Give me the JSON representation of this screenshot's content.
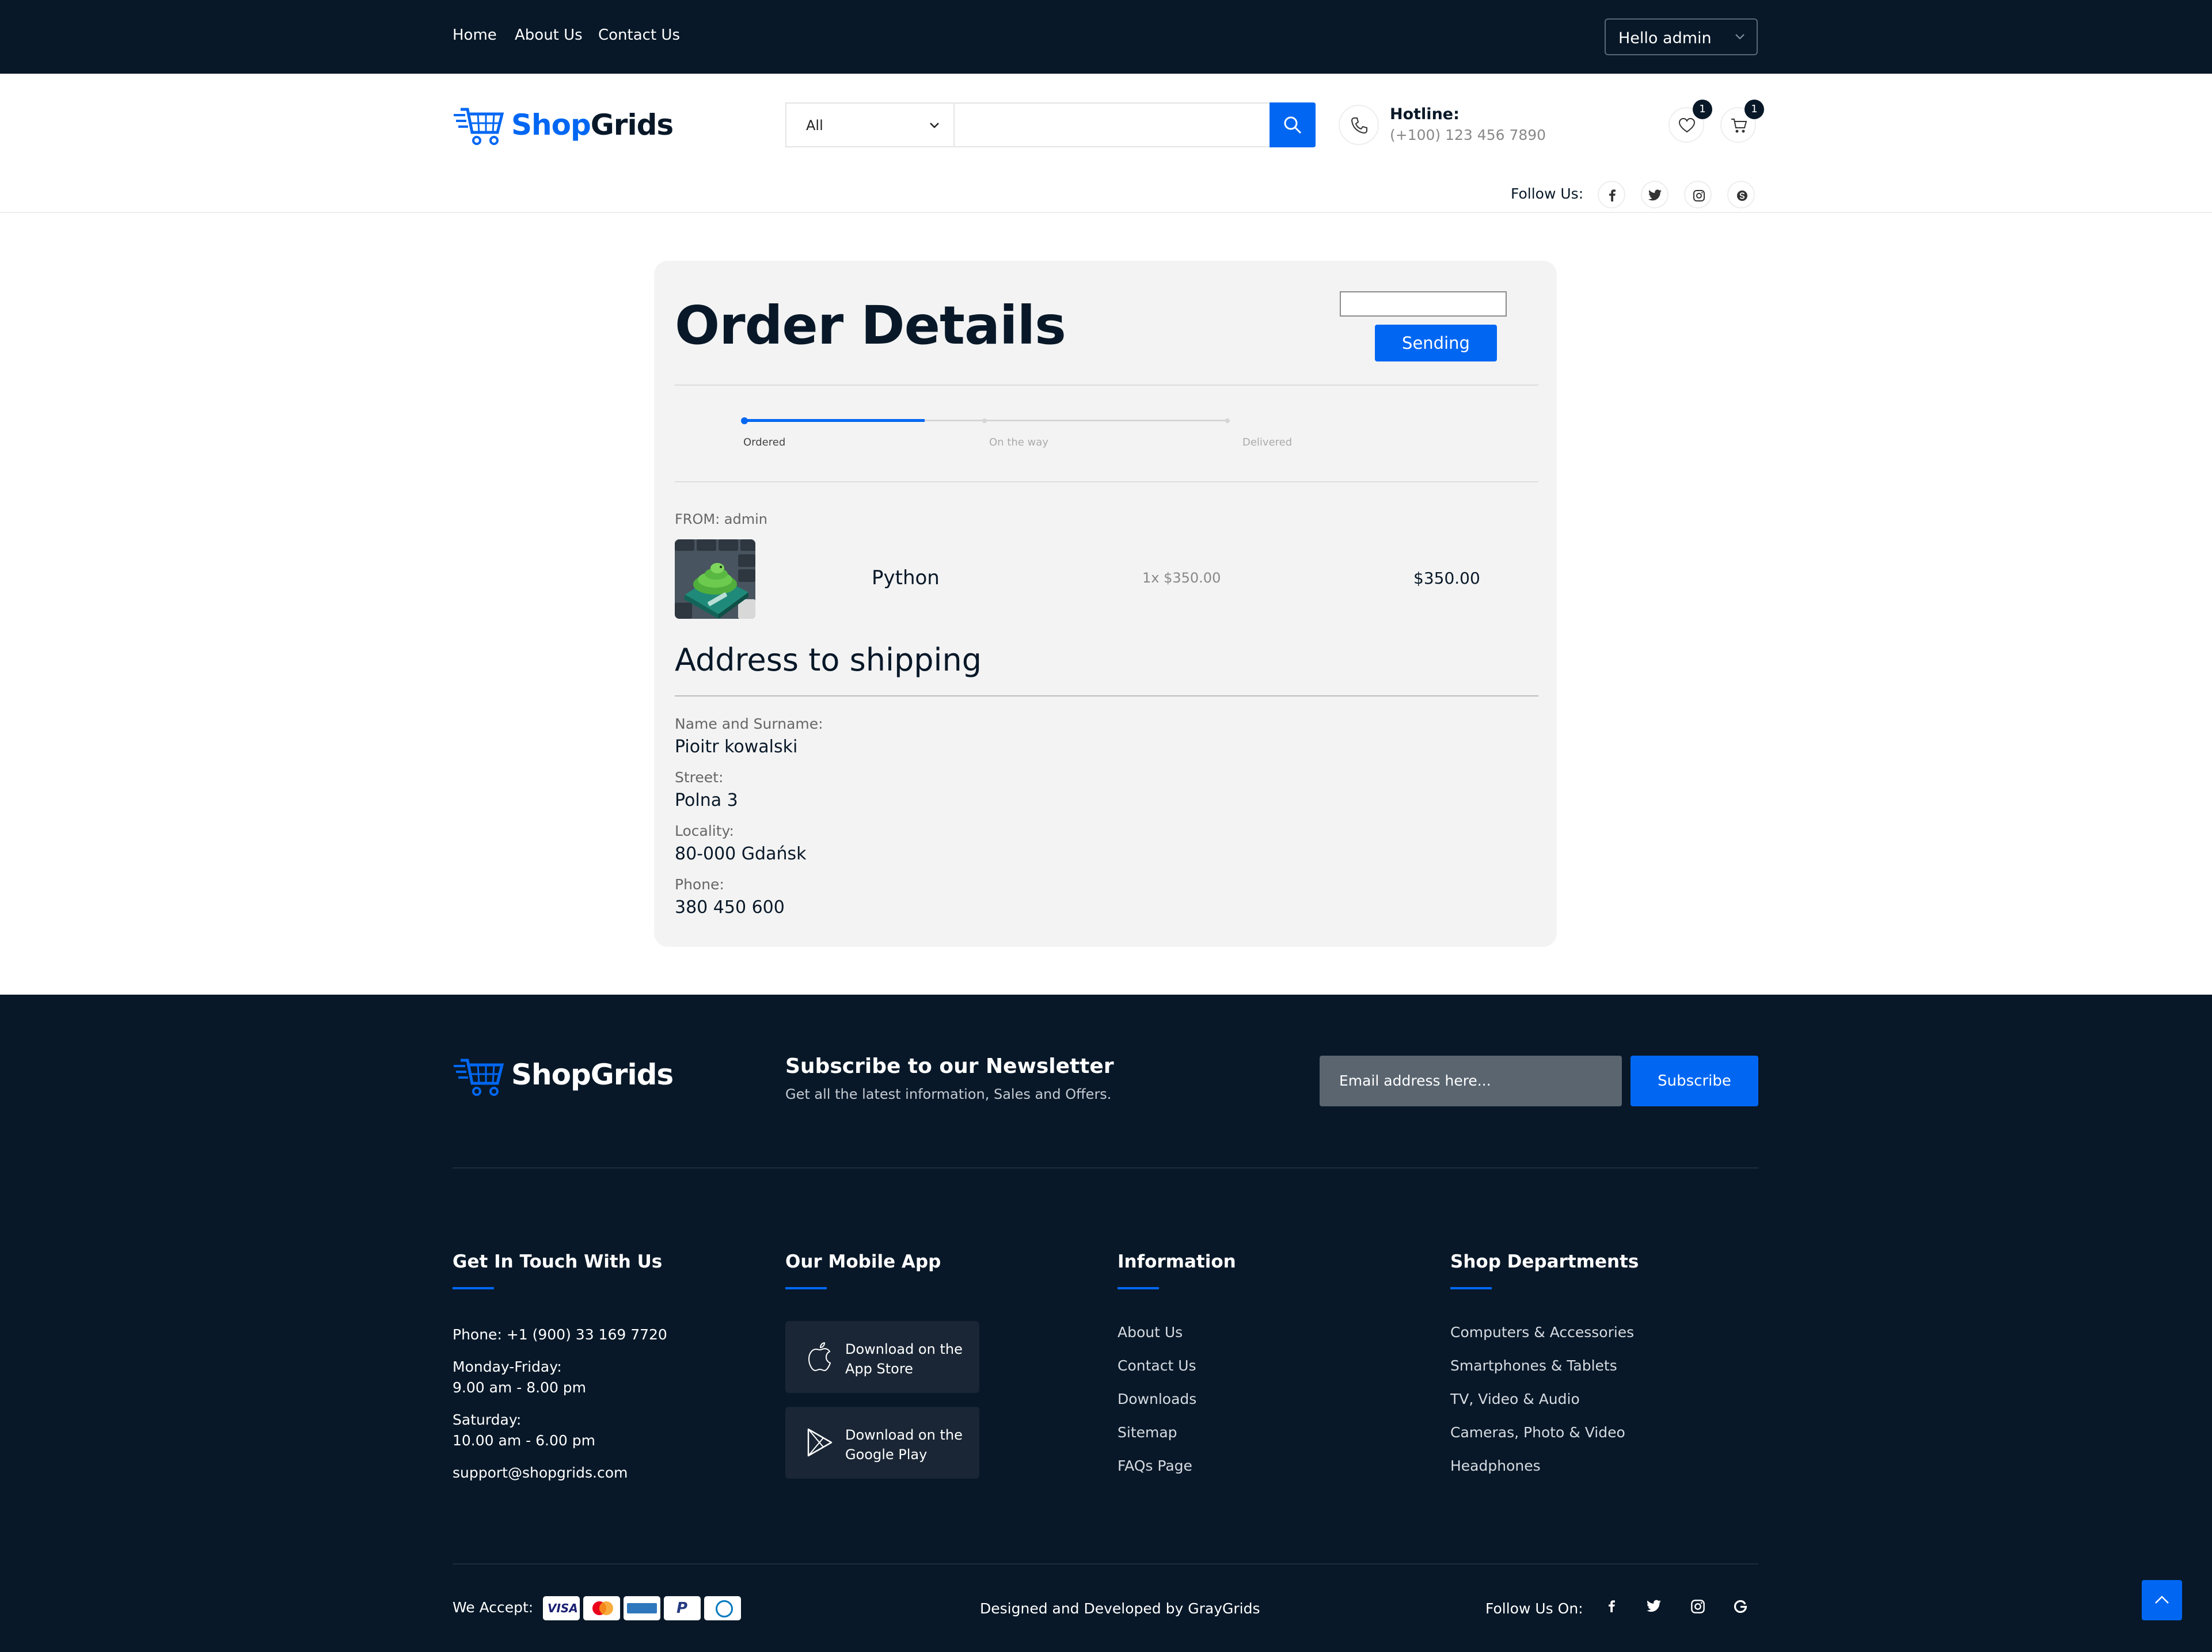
{
  "topbar": {
    "nav": [
      "Home",
      "About Us",
      "Contact Us"
    ],
    "user_menu": "Hello admin"
  },
  "header": {
    "logo": {
      "part1": "Shop",
      "part2": "Grids"
    },
    "search": {
      "category": "All",
      "placeholder": ""
    },
    "hotline": {
      "label": "Hotline:",
      "number": "(+100) 123 456 7890"
    },
    "wishlist_count": "1",
    "cart_count": "1"
  },
  "follow": {
    "label": "Follow Us:",
    "icons": [
      "facebook-icon",
      "twitter-icon",
      "instagram-icon",
      "skype-icon"
    ]
  },
  "order": {
    "title": "Order Details",
    "status_input": "",
    "status_button": "Sending",
    "progress": {
      "steps": [
        "Ordered",
        "On the way",
        "Delivered"
      ],
      "current_step": 1
    },
    "from": "FROM: admin",
    "item": {
      "name": "Python",
      "qty_price": "1x $350.00",
      "total": "$350.00"
    },
    "address_title": "Address to shipping",
    "address": {
      "name_label": "Name and Surname:",
      "name": "Pioitr kowalski",
      "street_label": "Street:",
      "street": "Polna 3",
      "locality_label": "Locality:",
      "locality": "80-000 Gdańsk",
      "phone_label": "Phone:",
      "phone": "380 450 600"
    }
  },
  "footer": {
    "logo": "ShopGrids",
    "newsletter": {
      "title": "Subscribe to our Newsletter",
      "subtitle": "Get all the latest information, Sales and Offers.",
      "placeholder": "Email address here...",
      "button": "Subscribe"
    },
    "contact": {
      "title": "Get In Touch With Us",
      "phone": "Phone: +1 (900) 33 169 7720",
      "weekday_label": "Monday-Friday:",
      "weekday_hours": "9.00 am - 8.00 pm",
      "saturday_label": "Saturday:",
      "saturday_hours": "10.00 am - 6.00 pm",
      "email": "support@shopgrids.com"
    },
    "app": {
      "title": "Our Mobile App",
      "appstore_line1": "Download on the",
      "appstore_line2": "App Store",
      "gplay_line1": "Download on the",
      "gplay_line2": "Google Play"
    },
    "information": {
      "title": "Information",
      "links": [
        "About Us",
        "Contact Us",
        "Downloads",
        "Sitemap",
        "FAQs Page"
      ]
    },
    "departments": {
      "title": "Shop Departments",
      "links": [
        "Computers & Accessories",
        "Smartphones & Tablets",
        "TV, Video & Audio",
        "Cameras, Photo & Video",
        "Headphones"
      ]
    },
    "bottom": {
      "we_accept": "We Accept:",
      "payment_icons": [
        "visa-icon",
        "mastercard-icon",
        "amex-icon",
        "paypal-icon",
        "diners-icon"
      ],
      "credit": "Designed and Developed by GrayGrids",
      "follow_label": "Follow Us On:",
      "social_icons": [
        "facebook-icon",
        "twitter-icon",
        "instagram-icon",
        "google-icon"
      ]
    }
  },
  "colors": {
    "dark": "#081828",
    "accent": "#0167f3",
    "card_bg": "#f3f3f3"
  }
}
